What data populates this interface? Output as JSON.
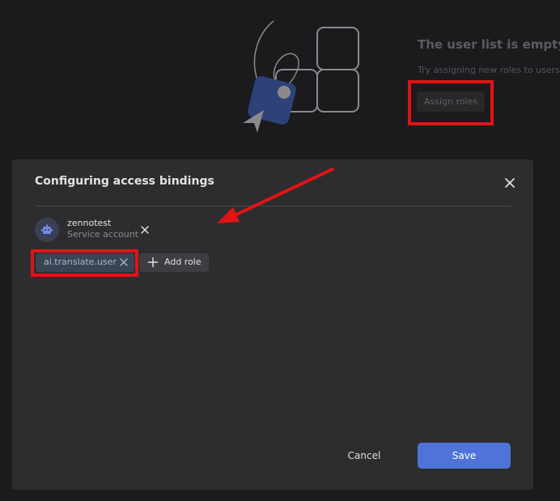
{
  "background_panel": {
    "empty_title": "The user list is empty",
    "empty_subtitle": "Try assigning new roles to users",
    "assign_roles_label": "Assign roles"
  },
  "dialog": {
    "title": "Configuring access bindings",
    "subject": {
      "name": "zennotest",
      "type": "Service account"
    },
    "role_chip": "ai.translate.user",
    "add_role_label": "Add role",
    "cancel_label": "Cancel",
    "save_label": "Save"
  },
  "colors": {
    "dialog_bg": "#2d2d30",
    "page_bg": "#1b1b1e",
    "accent": "#4f74d9",
    "annotation": "#e11414",
    "role_chip_bg": "#3a4553"
  },
  "icons": [
    "illustration-icon",
    "close-icon",
    "robot-icon",
    "remove-icon",
    "plus-icon"
  ]
}
